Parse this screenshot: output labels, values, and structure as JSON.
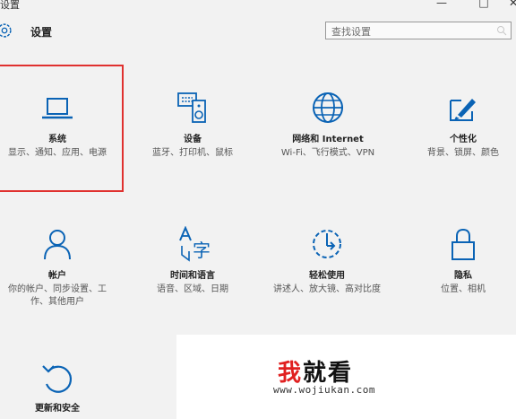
{
  "window": {
    "title": "设置",
    "controls": {
      "minimize": "—",
      "maximize": "□",
      "close": "✕"
    }
  },
  "header": {
    "title": "设置",
    "search": {
      "placeholder": "查找设置"
    }
  },
  "tiles": [
    {
      "icon": "laptop-icon",
      "title": "系统",
      "subtitle": "显示、通知、应用、电源",
      "highlighted": true
    },
    {
      "icon": "keyboard-speaker-icon",
      "title": "设备",
      "subtitle": "蓝牙、打印机、鼠标"
    },
    {
      "icon": "globe-icon",
      "title": "网络和 Internet",
      "subtitle": "Wi-Fi、飞行模式、VPN"
    },
    {
      "icon": "paint-brush-icon",
      "title": "个性化",
      "subtitle": "背景、锁屏、颜色"
    },
    {
      "icon": "person-icon",
      "title": "帐户",
      "subtitle": "你的帐户、同步设置、工作、其他用户"
    },
    {
      "icon": "language-icon",
      "title": "时间和语言",
      "subtitle": "语音、区域、日期"
    },
    {
      "icon": "ease-of-access-icon",
      "title": "轻松使用",
      "subtitle": "讲述人、放大镜、高对比度"
    },
    {
      "icon": "lock-icon",
      "title": "隐私",
      "subtitle": "位置、相机"
    },
    {
      "icon": "update-icon",
      "title": "更新和安全",
      "subtitle": ""
    }
  ],
  "watermark": {
    "logo_part1": "我",
    "logo_part2": "就看",
    "url": "www.wojiukan.com"
  },
  "colors": {
    "accent": "#0a63b5",
    "highlight_border": "#e0312f",
    "watermark_red": "#e02020"
  }
}
